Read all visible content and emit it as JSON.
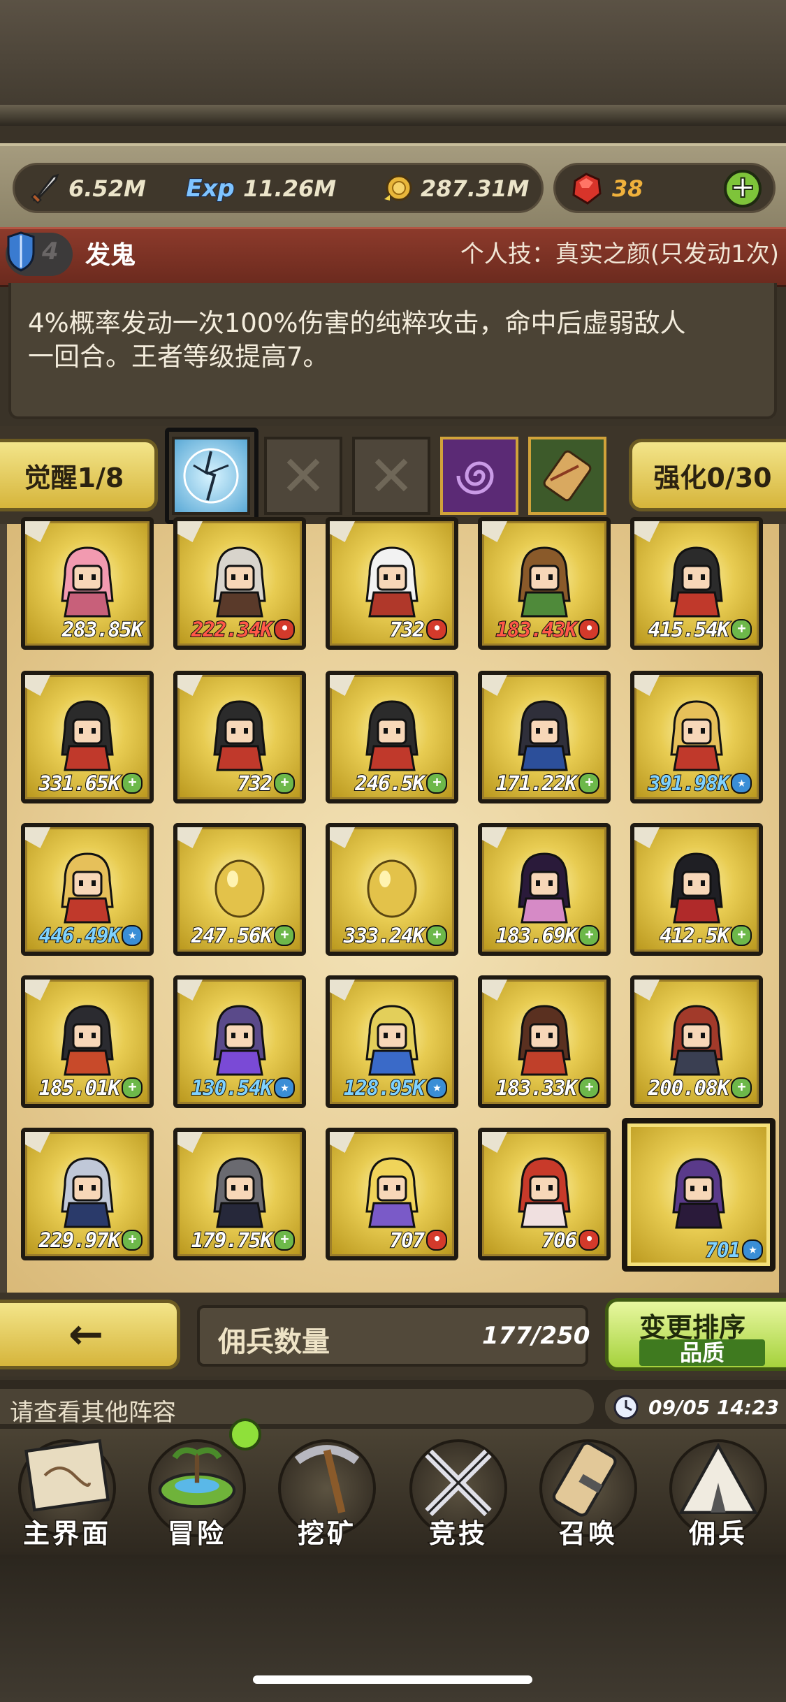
{
  "resources": {
    "attack": "6.52M",
    "exp_icon_label": "Exp",
    "exp": "11.26M",
    "gold": "287.31M",
    "gems": "38",
    "gem_color": "#f0b13c"
  },
  "hero": {
    "level": "4",
    "name": "发鬼",
    "skill_title": "个人技：真实之颜(只发动1次)",
    "skill_desc_line1": "4%概率发动一次100%伤害的纯粹攻击，命中后虚弱敌人",
    "skill_desc_line2": "一回合。王者等级提高7。"
  },
  "skills_row": {
    "awaken_label": "觉醒1/8",
    "enhance_label": "强化0/30",
    "slots": [
      "lightning-skill",
      "empty",
      "empty",
      "vortex-skill",
      "scroll-skill"
    ]
  },
  "mercenaries": [
    {
      "value": "283.85K",
      "badge": "",
      "color": "white",
      "hero": "pink-haired-girl"
    },
    {
      "value": "222.34K",
      "badge": "red",
      "color": "red",
      "hero": "bearded-elder"
    },
    {
      "value": "732",
      "badge": "red",
      "color": "white",
      "hero": "white-haired-warrior"
    },
    {
      "value": "183.43K",
      "badge": "red",
      "color": "red",
      "hero": "green-ranger"
    },
    {
      "value": "415.54K",
      "badge": "plus",
      "color": "white",
      "hero": "red-hooded-girl"
    },
    {
      "value": "331.65K",
      "badge": "plus",
      "color": "white",
      "hero": "red-hooded-girl"
    },
    {
      "value": "732",
      "badge": "plus",
      "color": "white",
      "hero": "red-hooded-girl"
    },
    {
      "value": "246.5K",
      "badge": "plus",
      "color": "white",
      "hero": "red-hooded-girl"
    },
    {
      "value": "171.22K",
      "badge": "plus",
      "color": "white",
      "hero": "dark-knight"
    },
    {
      "value": "391.98K",
      "badge": "star",
      "color": "blue",
      "hero": "crowned-priestess"
    },
    {
      "value": "446.49K",
      "badge": "star",
      "color": "blue",
      "hero": "crowned-priestess"
    },
    {
      "value": "247.56K",
      "badge": "plus",
      "color": "white",
      "hero": "golden-egg"
    },
    {
      "value": "333.24K",
      "badge": "plus",
      "color": "white",
      "hero": "golden-egg"
    },
    {
      "value": "183.69K",
      "badge": "plus",
      "color": "white",
      "hero": "flower-maiden"
    },
    {
      "value": "412.5K",
      "badge": "plus",
      "color": "white",
      "hero": "black-haired-girl"
    },
    {
      "value": "185.01K",
      "badge": "plus",
      "color": "white",
      "hero": "grey-haired-fighter"
    },
    {
      "value": "130.54K",
      "badge": "star",
      "color": "blue",
      "hero": "horned-demon"
    },
    {
      "value": "128.95K",
      "badge": "star",
      "color": "blue",
      "hero": "blue-mage"
    },
    {
      "value": "183.33K",
      "badge": "plus",
      "color": "white",
      "hero": "brown-haired-girl"
    },
    {
      "value": "200.08K",
      "badge": "plus",
      "color": "white",
      "hero": "hatted-gunner"
    },
    {
      "value": "229.97K",
      "badge": "plus",
      "color": "white",
      "hero": "silver-haired-sage"
    },
    {
      "value": "179.75K",
      "badge": "plus",
      "color": "white",
      "hero": "cat-eared-boy"
    },
    {
      "value": "707",
      "badge": "red",
      "color": "white",
      "hero": "blonde-knight"
    },
    {
      "value": "706",
      "badge": "red",
      "color": "white",
      "hero": "red-haired-girl"
    },
    {
      "value": "701",
      "badge": "star",
      "color": "blue",
      "hero": "purple-haired-ghost"
    }
  ],
  "controls": {
    "back_label": "←",
    "count_label": "佣兵数量",
    "count_value": "177/250",
    "sort_label": "变更排序",
    "sort_mode": "品质"
  },
  "status": {
    "message": "请查看其他阵容",
    "time": "09/05 14:23"
  },
  "nav": [
    {
      "label": "主界面",
      "icon": "map-scroll-icon"
    },
    {
      "label": "冒险",
      "icon": "island-icon"
    },
    {
      "label": "挖矿",
      "icon": "pickaxe-icon"
    },
    {
      "label": "竞技",
      "icon": "crossed-swords-icon"
    },
    {
      "label": "召唤",
      "icon": "summon-scroll-icon"
    },
    {
      "label": "佣兵",
      "icon": "tent-icon"
    }
  ]
}
